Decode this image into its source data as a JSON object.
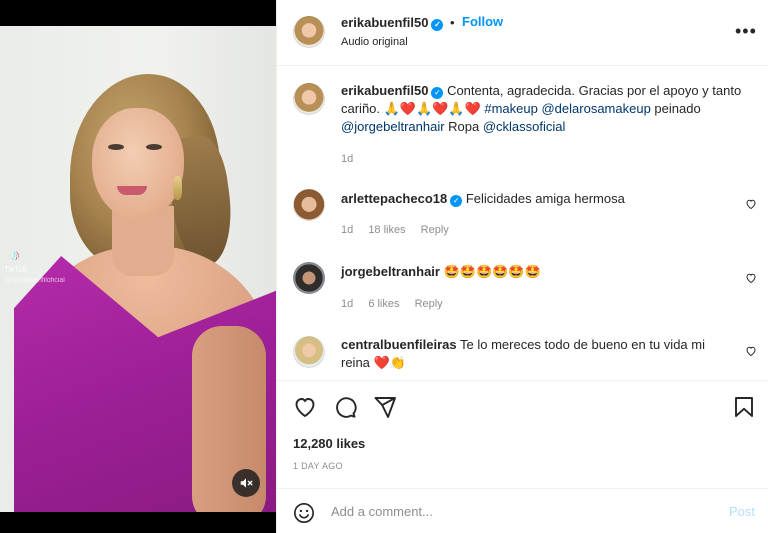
{
  "post": {
    "author": "erikabuenfil50",
    "dot": "•",
    "follow_label": "Follow",
    "audio": "Audio original",
    "more": "•••",
    "caption": {
      "text_1": "Contenta, agradecida. Gracias por el apoyo y tanto cariño. 🙏❤️🙏❤️🙏❤️ ",
      "tag_makeup": "#makeup",
      "tag_delarosa": "@delarosamakeup",
      "text_2": " peinado ",
      "tag_jorge": "@jorgebeltranhair",
      "text_3": " Ropa ",
      "tag_cklass": "@cklassoficial",
      "age": "1d"
    },
    "likes": "12,280 likes",
    "time_ago": "1 DAY AGO"
  },
  "video": {
    "watermark_brand": "TikTok",
    "watermark_handle": "@erikabuenfiloficial",
    "mute_icon": "speaker-muted-icon"
  },
  "comments": [
    {
      "user": "arlettepacheco18",
      "verified": true,
      "text": "Felicidades amiga hermosa",
      "age": "1d",
      "likes": "18 likes",
      "reply": "Reply"
    },
    {
      "user": "jorgebeltranhair",
      "verified": false,
      "text": "🤩🤩🤩🤩🤩🤩",
      "age": "1d",
      "likes": "6 likes",
      "reply": "Reply"
    },
    {
      "user": "centralbuenfileiras",
      "verified": false,
      "text": "Te lo mereces todo de bueno en tu vida mi reina ❤️👏"
    }
  ],
  "add_comment": {
    "placeholder": "Add a comment...",
    "post_label": "Post"
  },
  "colors": {
    "accent": "#0095f6",
    "link": "#00376b",
    "muted": "#8e8e8e",
    "post_disabled": "#b2dffc"
  }
}
